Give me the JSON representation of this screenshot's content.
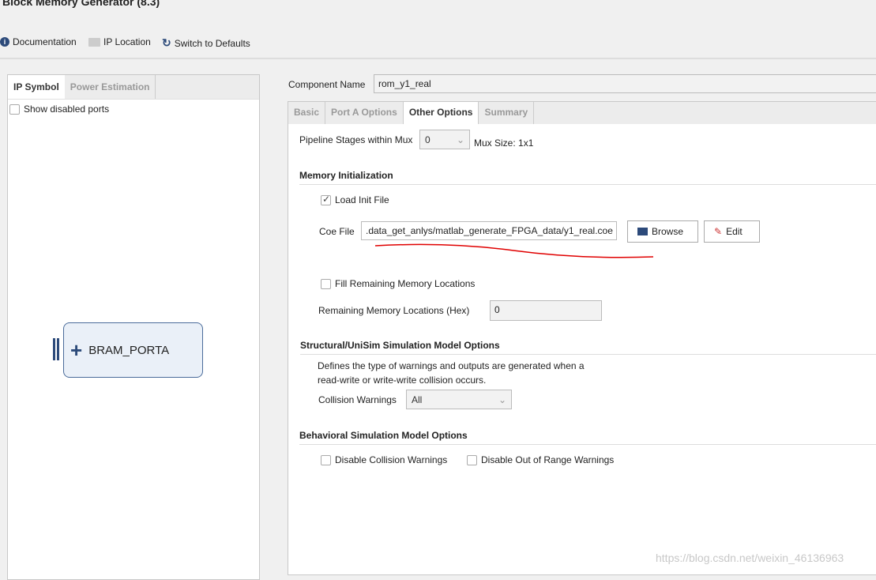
{
  "window": {
    "title": "Block Memory Generator (8.3)"
  },
  "toolbar": {
    "documentation": "Documentation",
    "ip_location": "IP Location",
    "switch_defaults": "Switch to Defaults"
  },
  "left_panel": {
    "tabs": [
      "IP Symbol",
      "Power Estimation"
    ],
    "show_disabled_ports": "Show disabled ports",
    "show_disabled_checked": false,
    "port": "BRAM_PORTA"
  },
  "component": {
    "label": "Component Name",
    "value": "rom_y1_real"
  },
  "tabs": [
    "Basic",
    "Port A Options",
    "Other Options",
    "Summary"
  ],
  "active_tab": "Other Options",
  "pipeline": {
    "label": "Pipeline Stages within Mux",
    "value": "0",
    "mux_size": "Mux Size: 1x1"
  },
  "memory_init": {
    "heading": "Memory Initialization",
    "load_init": "Load Init File",
    "load_init_checked": true,
    "coe_label": "Coe File",
    "coe_value": ".data_get_anlys/matlab_generate_FPGA_data/y1_real.coe",
    "browse": "Browse",
    "edit": "Edit",
    "fill_remaining": "Fill Remaining Memory Locations",
    "fill_checked": false,
    "remaining_label": "Remaining Memory Locations (Hex)",
    "remaining_value": "0"
  },
  "structural": {
    "heading": "Structural/UniSim Simulation Model Options",
    "desc1": "Defines the type of warnings and outputs are generated when a",
    "desc2": "read-write or write-write collision occurs.",
    "collision_label": "Collision Warnings",
    "collision_value": "All"
  },
  "behavioral": {
    "heading": "Behavioral Simulation Model Options",
    "disable_collision": "Disable Collision Warnings",
    "disable_out_of_range": "Disable Out of Range Warnings"
  },
  "watermark": "https://blog.csdn.net/weixin_46136963",
  "colors": {
    "annotation": "#e00000",
    "accent": "#2c4a7a"
  }
}
